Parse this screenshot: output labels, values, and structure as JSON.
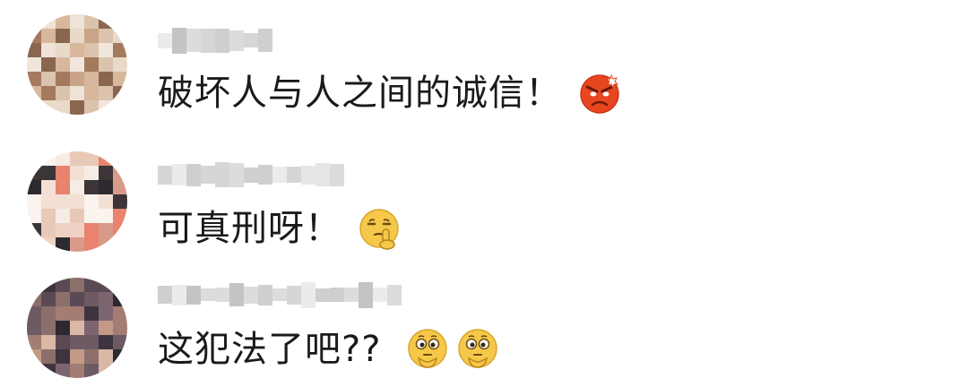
{
  "comments": [
    {
      "username": "",
      "text": "破坏人与人之间的诚信！",
      "emojis": [
        "angry-face-icon"
      ]
    },
    {
      "username": "",
      "text": "可真刑呀！",
      "emojis": [
        "shush-face-icon"
      ]
    },
    {
      "username": "",
      "text": "这犯法了吧??",
      "emojis": [
        "thinking-face-icon",
        "thinking-face-icon"
      ]
    }
  ],
  "colors": {
    "text": "#1a1a1a",
    "username_blur": "#d8d8d8",
    "emoji_angry": "#e8461f",
    "emoji_yellow": "#f5c84a"
  }
}
